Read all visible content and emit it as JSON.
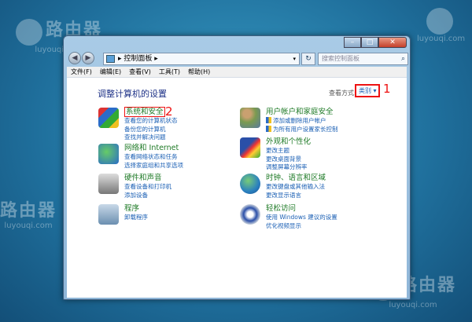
{
  "watermark": {
    "text": "路由器",
    "url": "luyouqi.com"
  },
  "window": {
    "controls": {
      "minimize": "–",
      "maximize": "□",
      "close": "✕"
    },
    "address": {
      "path": "控制面板",
      "sep": "▸",
      "dropdown": "▾"
    },
    "refresh": "↻",
    "search_placeholder": "搜索控制面板",
    "menu": [
      "文件(F)",
      "编辑(E)",
      "查看(V)",
      "工具(T)",
      "帮助(H)"
    ]
  },
  "content": {
    "title": "调整计算机的设置",
    "view_by_label": "查看方式:",
    "view_by_value": "类别 ▾",
    "annotations": [
      "1",
      "2"
    ],
    "categories": [
      {
        "title": "系统和安全",
        "links": [
          "查看您的计算机状态",
          "备份您的计算机",
          "查找并解决问题"
        ],
        "icon": "shield-icon",
        "color": "#2a6cc8"
      },
      {
        "title": "网络和 Internet",
        "links": [
          "查看网络状态和任务",
          "选择家庭组和共享选项"
        ],
        "icon": "network-icon",
        "color": "#2a9c4a"
      },
      {
        "title": "硬件和声音",
        "links": [
          "查看设备和打印机",
          "添加设备"
        ],
        "icon": "printer-icon",
        "color": "#8a8f96"
      },
      {
        "title": "程序",
        "links": [
          "卸载程序"
        ],
        "icon": "programs-icon",
        "color": "#6b8fb0"
      },
      {
        "title": "用户帐户和家庭安全",
        "links": [
          "添加或删除用户帐户",
          "为所有用户设置家长控制"
        ],
        "icon": "users-icon",
        "color": "#7a9a50"
      },
      {
        "title": "外观和个性化",
        "links": [
          "更改主题",
          "更改桌面背景",
          "调整屏幕分辨率"
        ],
        "icon": "appearance-icon",
        "color": "#d0603a"
      },
      {
        "title": "时钟、语言和区域",
        "links": [
          "更改键盘或其他输入法",
          "更改显示语言"
        ],
        "icon": "globe-clock-icon",
        "color": "#2a80c0"
      },
      {
        "title": "轻松访问",
        "links": [
          "使用 Windows 建议的设置",
          "优化视频显示"
        ],
        "icon": "accessibility-icon",
        "color": "#2a4fa8"
      }
    ]
  }
}
